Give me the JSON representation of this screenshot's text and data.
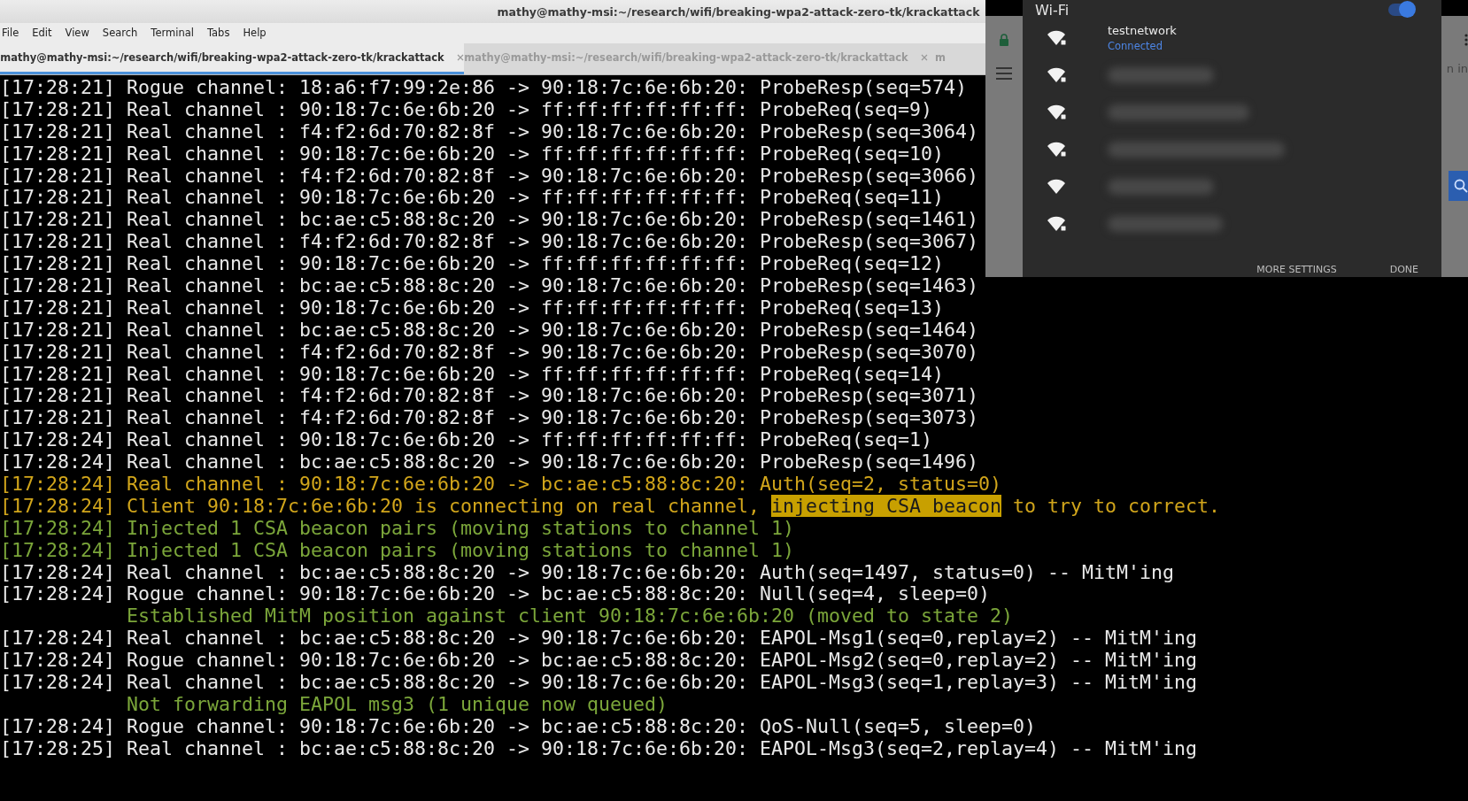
{
  "window": {
    "title": "mathy@mathy-msi:~/research/wifi/breaking-wpa2-attack-zero-tk/krackattack"
  },
  "menu": [
    "File",
    "Edit",
    "View",
    "Search",
    "Terminal",
    "Tabs",
    "Help"
  ],
  "tabs": [
    {
      "label": "mathy@mathy-msi:~/research/wifi/breaking-wpa2-attack-zero-tk/krackattack",
      "selected": true,
      "closable": true
    },
    {
      "label": "mathy@mathy-msi:~/research/wifi/breaking-wpa2-attack-zero-tk/krackattack",
      "selected": false,
      "closable": true
    },
    {
      "label": "m",
      "selected": false,
      "closable": false
    }
  ],
  "terminal": {
    "lines": [
      {
        "kind": "plain",
        "text": "[17:28:21] Rogue channel: 18:a6:f7:99:2e:86 -> 90:18:7c:6e:6b:20: ProbeResp(seq=574)"
      },
      {
        "kind": "plain",
        "text": "[17:28:21] Real channel : 90:18:7c:6e:6b:20 -> ff:ff:ff:ff:ff:ff: ProbeReq(seq=9)"
      },
      {
        "kind": "plain",
        "text": "[17:28:21] Real channel : f4:f2:6d:70:82:8f -> 90:18:7c:6e:6b:20: ProbeResp(seq=3064)"
      },
      {
        "kind": "plain",
        "text": "[17:28:21] Real channel : 90:18:7c:6e:6b:20 -> ff:ff:ff:ff:ff:ff: ProbeReq(seq=10)"
      },
      {
        "kind": "plain",
        "text": "[17:28:21] Real channel : f4:f2:6d:70:82:8f -> 90:18:7c:6e:6b:20: ProbeResp(seq=3066)"
      },
      {
        "kind": "plain",
        "text": "[17:28:21] Real channel : 90:18:7c:6e:6b:20 -> ff:ff:ff:ff:ff:ff: ProbeReq(seq=11)"
      },
      {
        "kind": "plain",
        "text": "[17:28:21] Real channel : bc:ae:c5:88:8c:20 -> 90:18:7c:6e:6b:20: ProbeResp(seq=1461)"
      },
      {
        "kind": "plain",
        "text": "[17:28:21] Real channel : f4:f2:6d:70:82:8f -> 90:18:7c:6e:6b:20: ProbeResp(seq=3067)"
      },
      {
        "kind": "plain",
        "text": "[17:28:21] Real channel : 90:18:7c:6e:6b:20 -> ff:ff:ff:ff:ff:ff: ProbeReq(seq=12)"
      },
      {
        "kind": "plain",
        "text": "[17:28:21] Real channel : bc:ae:c5:88:8c:20 -> 90:18:7c:6e:6b:20: ProbeResp(seq=1463)"
      },
      {
        "kind": "plain",
        "text": "[17:28:21] Real channel : 90:18:7c:6e:6b:20 -> ff:ff:ff:ff:ff:ff: ProbeReq(seq=13)"
      },
      {
        "kind": "plain",
        "text": "[17:28:21] Real channel : bc:ae:c5:88:8c:20 -> 90:18:7c:6e:6b:20: ProbeResp(seq=1464)"
      },
      {
        "kind": "plain",
        "text": "[17:28:21] Real channel : f4:f2:6d:70:82:8f -> 90:18:7c:6e:6b:20: ProbeResp(seq=3070)"
      },
      {
        "kind": "plain",
        "text": "[17:28:21] Real channel : 90:18:7c:6e:6b:20 -> ff:ff:ff:ff:ff:ff: ProbeReq(seq=14)"
      },
      {
        "kind": "plain",
        "text": "[17:28:21] Real channel : f4:f2:6d:70:82:8f -> 90:18:7c:6e:6b:20: ProbeResp(seq=3071)"
      },
      {
        "kind": "plain",
        "text": "[17:28:21] Real channel : f4:f2:6d:70:82:8f -> 90:18:7c:6e:6b:20: ProbeResp(seq=3073)"
      },
      {
        "kind": "plain",
        "text": "[17:28:24] Real channel : 90:18:7c:6e:6b:20 -> ff:ff:ff:ff:ff:ff: ProbeReq(seq=1)"
      },
      {
        "kind": "plain",
        "text": "[17:28:24] Real channel : bc:ae:c5:88:8c:20 -> 90:18:7c:6e:6b:20: ProbeResp(seq=1496)"
      },
      {
        "kind": "warning",
        "text": "[17:28:24] Real channel : 90:18:7c:6e:6b:20 -> bc:ae:c5:88:8c:20: Auth(seq=2, status=0)"
      },
      {
        "kind": "warning",
        "text": "[17:28:24] Client 90:18:7c:6e:6b:20 is connecting on real channel, ",
        "highlighted": "injecting CSA beacon",
        "text_after": " to try to correct."
      },
      {
        "kind": "info",
        "text": "[17:28:24] Injected 1 CSA beacon pairs (moving stations to channel 1)"
      },
      {
        "kind": "info",
        "text": "[17:28:24] Injected 1 CSA beacon pairs (moving stations to channel 1)"
      },
      {
        "kind": "plain",
        "text": "[17:28:24] Real channel : bc:ae:c5:88:8c:20 -> 90:18:7c:6e:6b:20: Auth(seq=1497, status=0) -- MitM'ing"
      },
      {
        "kind": "plain",
        "text": "[17:28:24] Rogue channel: 90:18:7c:6e:6b:20 -> bc:ae:c5:88:8c:20: Null(seq=4, sleep=0)"
      },
      {
        "kind": "note",
        "text": "Established MitM position against client 90:18:7c:6e:6b:20 (moved to state 2)"
      },
      {
        "kind": "plain",
        "text": "[17:28:24] Real channel : bc:ae:c5:88:8c:20 -> 90:18:7c:6e:6b:20: EAPOL-Msg1(seq=0,replay=2) -- MitM'ing"
      },
      {
        "kind": "plain",
        "text": "[17:28:24] Rogue channel: 90:18:7c:6e:6b:20 -> bc:ae:c5:88:8c:20: EAPOL-Msg2(seq=0,replay=2) -- MitM'ing"
      },
      {
        "kind": "plain",
        "text": "[17:28:24] Real channel : bc:ae:c5:88:8c:20 -> 90:18:7c:6e:6b:20: EAPOL-Msg3(seq=1,replay=3) -- MitM'ing"
      },
      {
        "kind": "note",
        "text": "Not forwarding EAPOL msg3 (1 unique now queued)"
      },
      {
        "kind": "plain",
        "text": "[17:28:24] Rogue channel: 90:18:7c:6e:6b:20 -> bc:ae:c5:88:8c:20: QoS-Null(seq=5, sleep=0)"
      },
      {
        "kind": "plain",
        "text": "[17:28:25] Real channel : bc:ae:c5:88:8c:20 -> 90:18:7c:6e:6b:20: EAPOL-Msg3(seq=2,replay=4) -- MitM'ing"
      }
    ]
  },
  "wifi_panel": {
    "title": "Wi-Fi",
    "on": true,
    "networks": [
      {
        "name": "testnetwork",
        "status": "Connected",
        "locked": true
      },
      {
        "locked": true
      },
      {
        "locked": true
      },
      {
        "locked": true
      },
      {
        "locked": false
      },
      {
        "locked": true
      }
    ],
    "buttons": [
      "MORE SETTINGS",
      "DONE"
    ],
    "background": {
      "sign_in": "n in"
    }
  }
}
